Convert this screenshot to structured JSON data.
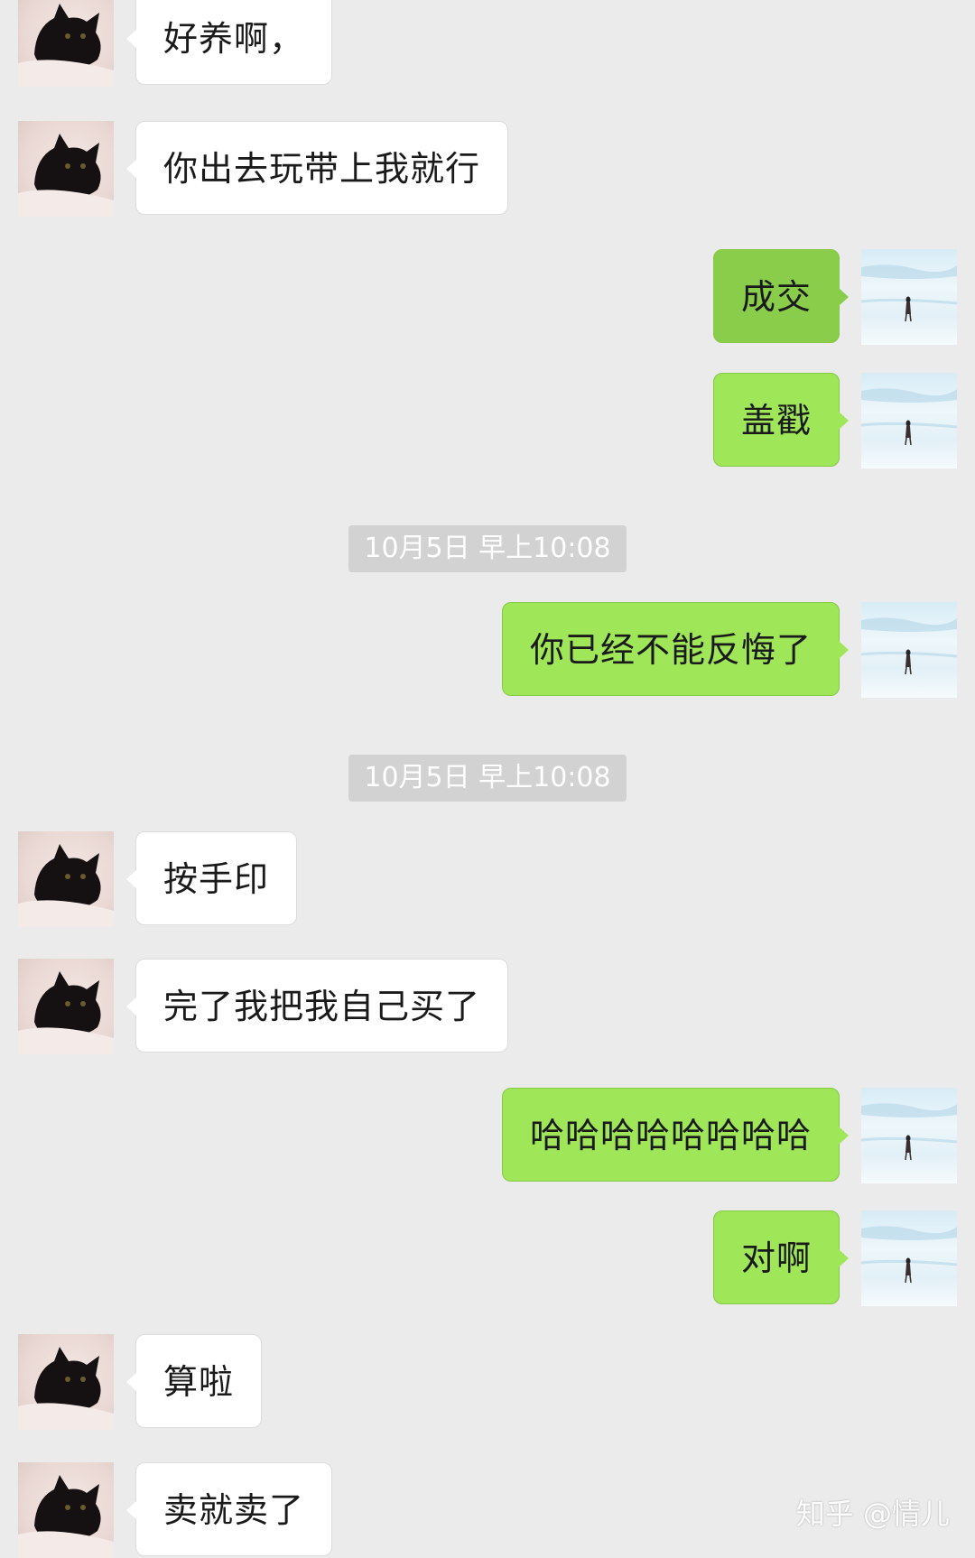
{
  "chat": {
    "messages": [
      {
        "side": "left",
        "text": "好养啊，"
      },
      {
        "side": "left",
        "text": "你出去玩带上我就行"
      },
      {
        "side": "right",
        "text": "成交"
      },
      {
        "side": "right",
        "text": "盖戳"
      },
      {
        "side": "right",
        "text": "你已经不能反悔了"
      },
      {
        "side": "left",
        "text": "按手印"
      },
      {
        "side": "left",
        "text": "完了我把我自己买了"
      },
      {
        "side": "right",
        "text": "哈哈哈哈哈哈哈哈"
      },
      {
        "side": "right",
        "text": "对啊"
      },
      {
        "side": "left",
        "text": "算啦"
      },
      {
        "side": "left",
        "text": "卖就卖了"
      }
    ],
    "timestamps": [
      {
        "text": "10月5日 早上10:08"
      },
      {
        "text": "10月5日 早上10:08"
      }
    ]
  },
  "avatars": {
    "contact": "black-cat-avatar",
    "self": "seaside-girl-avatar"
  },
  "colors": {
    "background": "#ebebeb",
    "sent_bubble": "#9fe658",
    "received_bubble": "#ffffff",
    "timestamp_bg": "#d2d2d2"
  },
  "watermark": {
    "text": "知乎 @情儿"
  }
}
